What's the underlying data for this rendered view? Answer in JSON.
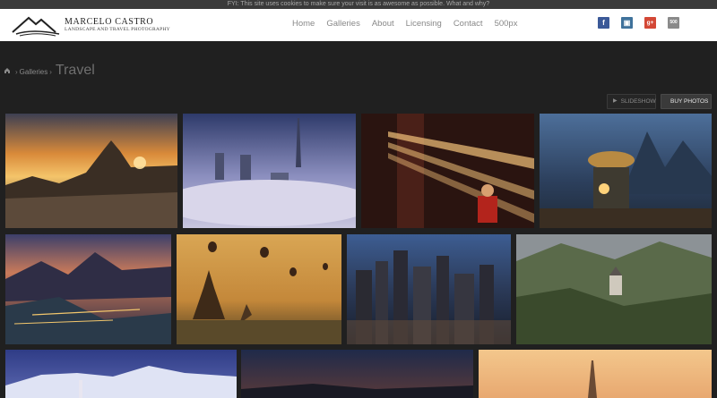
{
  "cookie_bar": {
    "text": "FYI: This site uses cookies to make sure your visit is as awesome as possible. What and why?"
  },
  "brand": {
    "name": "MARCELO CASTRO",
    "tagline": "LANDSCAPE AND TRAVEL PHOTOGRAPHY"
  },
  "nav": {
    "items": [
      "Home",
      "Galleries",
      "About",
      "Licensing",
      "Contact",
      "500px"
    ]
  },
  "social": {
    "fb": "f",
    "ig": "▣",
    "gp": "g+",
    "px": "500"
  },
  "breadcrumb": {
    "parent": "Galleries",
    "current": "Travel"
  },
  "toolbar": {
    "slideshow": "SLIDESHOW",
    "buy": "BUY PHOTOS"
  },
  "gallery": {
    "photos": [
      {
        "name": "rio-sunset-photo",
        "icon": "rio-sunset"
      },
      {
        "name": "dubai-fog-photo",
        "icon": "dubai-towers"
      },
      {
        "name": "monk-light-rays-photo",
        "icon": "light-rays"
      },
      {
        "name": "fisherman-cormorant-photo",
        "icon": "fisherman"
      },
      {
        "name": "rio-night-photo",
        "icon": "bay-night"
      },
      {
        "name": "bagan-balloons-photo",
        "icon": "balloons"
      },
      {
        "name": "city-skyline-photo",
        "icon": "skyline"
      },
      {
        "name": "neuschwanstein-photo",
        "icon": "castle"
      },
      {
        "name": "snowy-mountain-church-photo",
        "icon": "mountain"
      },
      {
        "name": "dusk-valley-photo",
        "icon": "dusk"
      },
      {
        "name": "tower-sunset-photo",
        "icon": "tower"
      }
    ]
  }
}
